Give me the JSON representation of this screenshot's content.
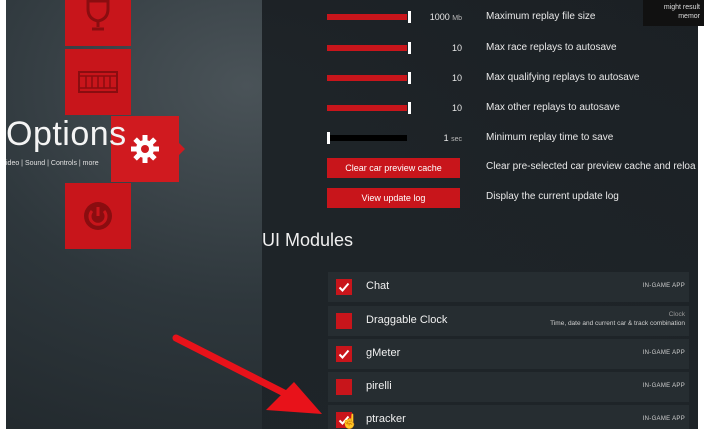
{
  "page": {
    "title": "Options",
    "subtitle": "ideo | Sound | Controls | more"
  },
  "menu": {
    "tiles": [
      {
        "name": "trophy",
        "icon": "trophy-icon"
      },
      {
        "name": "replay",
        "icon": "film-strip-icon"
      },
      {
        "name": "settings",
        "icon": "gear-icon",
        "active": true
      },
      {
        "name": "power",
        "icon": "power-icon"
      }
    ]
  },
  "replay_settings": [
    {
      "value": "1000",
      "unit": "Mb",
      "label": "Maximum replay file size",
      "fill_fraction": 1.0
    },
    {
      "value": "10",
      "unit": "",
      "label": "Max race replays to autosave",
      "fill_fraction": 1.0
    },
    {
      "value": "10",
      "unit": "",
      "label": "Max qualifying replays to autosave",
      "fill_fraction": 1.0
    },
    {
      "value": "10",
      "unit": "",
      "label": "Max other replays to autosave",
      "fill_fraction": 1.0
    },
    {
      "value": "1",
      "unit": "sec",
      "label": "Minimum replay time to save",
      "fill_fraction": 0.0
    }
  ],
  "buttons": [
    {
      "label": "Clear car preview cache",
      "desc": "Clear pre-selected car preview cache and reloa"
    },
    {
      "label": "View update log",
      "desc": "Display the current update log"
    }
  ],
  "tooltip": {
    "line1": "might result",
    "line2": "memor"
  },
  "ui_modules": {
    "title": "UI Modules",
    "items": [
      {
        "name": "Chat",
        "checked": true,
        "tag": "IN-GAME APP"
      },
      {
        "name": "Draggable Clock",
        "checked": false,
        "tag_title": "Clock",
        "tag": "Time, date and current car & track combination"
      },
      {
        "name": "gMeter",
        "checked": true,
        "tag": "IN-GAME APP"
      },
      {
        "name": "pirelli",
        "checked": false,
        "tag": "IN-GAME APP"
      },
      {
        "name": "ptracker",
        "checked": true,
        "tag": "IN-GAME APP"
      }
    ]
  },
  "colors": {
    "accent": "#c8151b",
    "background": "#1e2428",
    "annotation_arrow": "#e8121a"
  }
}
